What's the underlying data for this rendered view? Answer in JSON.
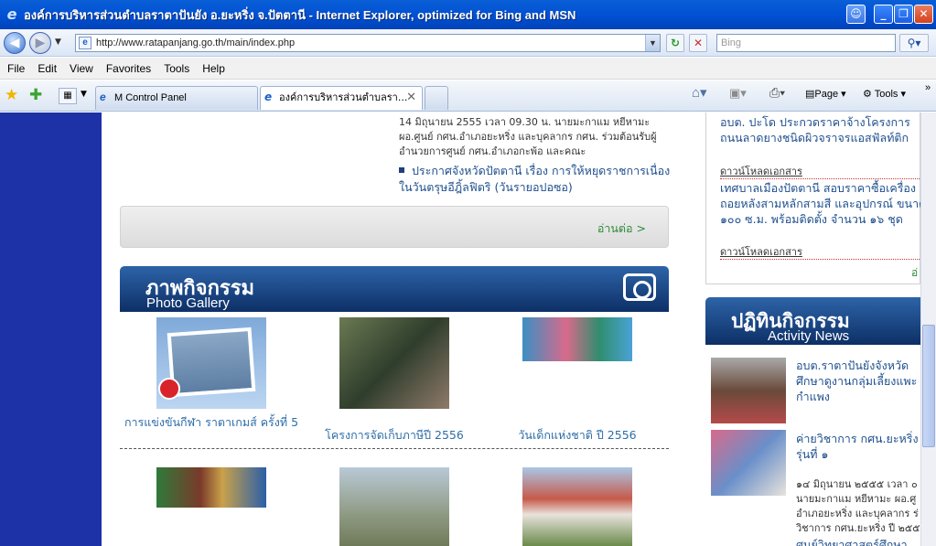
{
  "window": {
    "title": "องค์การบริหารส่วนตำบลราตาปันยัง อ.ยะหริ่ง จ.ปัตตานี - Internet Explorer, optimized for Bing and MSN"
  },
  "address": {
    "url": "http://www.ratapanjang.go.th/main/index.php",
    "search_placeholder": "Bing"
  },
  "menu": [
    "File",
    "Edit",
    "View",
    "Favorites",
    "Tools",
    "Help"
  ],
  "tabs": [
    {
      "label": "M Control Panel"
    },
    {
      "label": "องค์การบริหารส่วนตำบลรา..."
    }
  ],
  "commandbar": {
    "page": "Page",
    "tools": "Tools"
  },
  "news": {
    "text": "14 มิถุนายน 2555 เวลา 09.30 น. นายมะกาแม หยีหามะ ผอ.ศูนย์ กศน.อำเภอยะหริ่ง และบุคลากร กศน. ร่วมต้อนรับผู้อำนวยการศูนย์ กศน.อำเภอกะพ้อ และคณะ",
    "link": "ประกาศจังหวัดปัตตานี เรื่อง การให้หยุดราชการเนื่องในวันตรุษอีฎิ้ลฟิตริ (วันรายอปอซอ)",
    "read_more": "อ่านต่อ >"
  },
  "gallery": {
    "title_th": "ภาพกิจกรรม",
    "title_en": "Photo Gallery",
    "items": [
      {
        "caption": "การแข่งขันกีฬา ราตาเกมส์ ครั้งที่ 5"
      },
      {
        "caption": "โครงการจัดเก็บภาษีปี 2556"
      },
      {
        "caption": "วันเด็กแห่งชาติ ปี 2556"
      }
    ]
  },
  "right": {
    "items": [
      {
        "text": "อบต. ปะโด ประกวดราคาจ้างโครงการ"
      },
      {
        "text": "ถนนลาดยางชนิดผิวจราจรแอสฟัลท์ติก"
      },
      {
        "download": "ดาวน์โหลดเอกสาร"
      },
      {
        "text": "เทศบาลเมืองปัตตานี สอบราคาซื้อเครื่อง"
      },
      {
        "text": "ถอยหลังสามหลักสามสี และอุปกรณ์ ขนาด"
      },
      {
        "text": "๑๐๐ ซ.ม. พร้อมติดตั้ง จำนวน ๑๖ ชุด"
      },
      {
        "download": "ดาวน์โหลดเอกสาร"
      }
    ],
    "more": "อ่",
    "activity": {
      "title_th": "ปฏิทินกิจกรรม",
      "title_en": "Activity News",
      "item1": [
        "อบต.ราตาปันยังจังหวัด",
        "ศึกษาดูงานกลุ่มเลี้ยงแพะ",
        "กำแพง"
      ],
      "item2": [
        "ค่ายวิชาการ กศน.ยะหริ่ง",
        "รุ่นที่ ๑"
      ],
      "item2_body": [
        "๑๔ มิถุนายน ๒๕๕๕ เวลา ๐",
        "นายมะกาแม หยีหามะ ผอ.ศู",
        "อำเภอยะหริ่ง และบุคลากร ร่",
        "วิชาการ กศน.ยะหริ่ง ปี ๒๕๕"
      ],
      "item3": "ศูนย์วิทยาศาสตร์ศึกษา"
    }
  }
}
